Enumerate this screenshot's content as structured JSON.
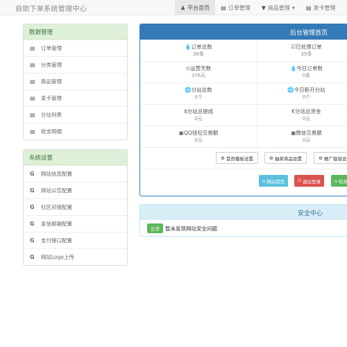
{
  "navbar": {
    "brand": "自助下单系统管理中心",
    "items": [
      {
        "label": "平台首页",
        "icon": "user-icon",
        "glyph": "👤",
        "active": true
      },
      {
        "label": "订单管理",
        "icon": "list-icon",
        "glyph": "▤",
        "active": false
      },
      {
        "label": "商品管理",
        "icon": "cart-icon",
        "glyph": "🛒",
        "active": false,
        "caret": "▾"
      },
      {
        "label": "发卡管理",
        "icon": "list-icon",
        "glyph": "▤",
        "active": false
      }
    ]
  },
  "sidebar_data": {
    "title": "数据管理",
    "items": [
      {
        "label": "订单管理"
      },
      {
        "label": "分类管理"
      },
      {
        "label": "商品管理"
      },
      {
        "label": "发卡管理"
      },
      {
        "label": "分站列表"
      },
      {
        "label": "收支明细"
      }
    ]
  },
  "sidebar_settings": {
    "title": "系统设置",
    "items": [
      {
        "label": "网站信息配置"
      },
      {
        "label": "网站公告配置"
      },
      {
        "label": "社区对接配置"
      },
      {
        "label": "发信邮箱配置"
      },
      {
        "label": "支付接口配置"
      },
      {
        "label": "网站Logo上传"
      }
    ]
  },
  "main": {
    "title": "后台管理首页",
    "stats": [
      {
        "label": "订单总数",
        "value": "36条",
        "icon": "tint-icon",
        "glyph": "💧"
      },
      {
        "label": "已处理订单",
        "value": "35条",
        "icon": "check-icon",
        "glyph": "☑"
      },
      {
        "label": "运营天数",
        "value": "376天",
        "icon": "clock-icon",
        "glyph": "⊙"
      },
      {
        "label": "今日订单数",
        "value": "0条",
        "icon": "tint-icon",
        "glyph": "💧"
      },
      {
        "label": "分站总数",
        "value": "0个",
        "icon": "globe-icon",
        "glyph": "🌐"
      },
      {
        "label": "今日新开分站",
        "value": "0个",
        "icon": "globe-icon",
        "glyph": "🌐"
      },
      {
        "label": "分站总提成",
        "value": "0元",
        "icon": "dollar-icon",
        "glyph": "$"
      },
      {
        "label": "分站总资金",
        "value": "0元",
        "icon": "euro-icon",
        "glyph": "€"
      },
      {
        "label": "QQ钱包交易额",
        "value": "0元",
        "icon": "credit-card-icon",
        "glyph": "▣"
      },
      {
        "label": "微信交易额",
        "value": "0元",
        "icon": "credit-card-icon",
        "glyph": "▣"
      }
    ],
    "settings_buttons": [
      {
        "label": "首页模板设置",
        "glyph": "⚙"
      },
      {
        "label": "抽奖商品设置",
        "glyph": "⚙"
      },
      {
        "label": "推广链接设置",
        "glyph": "⚙"
      }
    ],
    "action_buttons": [
      {
        "label": "网站首页",
        "glyph": "⌂",
        "color": "#5bc0de"
      },
      {
        "label": "退出登录",
        "glyph": "⏻",
        "color": "#d9534f"
      },
      {
        "label": "检测更新",
        "glyph": "⌂",
        "color": "#5cb85c"
      }
    ]
  },
  "security": {
    "title": "安全中心",
    "badge": "正常",
    "message": "暂未发现网站安全问题"
  }
}
